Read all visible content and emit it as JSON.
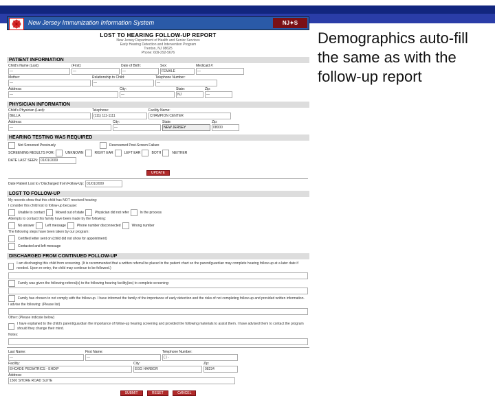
{
  "bars": {
    "system_title": "New Jersey Immunization Information System",
    "badge": "NJ✦S"
  },
  "header": {
    "report_title": "LOST TO HEARING FOLLOW-UP REPORT",
    "line1": "New Jersey Department of Health and Senior Services",
    "line2": "Early Hearing Detection and Intervention Program",
    "line3": "Trenton, NJ 08625",
    "line4": "Phone: 609-292-5676"
  },
  "sections": {
    "patient": "PATIENT INFORMATION",
    "physician": "PHYSICIAN INFORMATION",
    "required": "HEARING TESTING WAS REQUIRED",
    "lost": "LOST TO FOLLOW-UP",
    "discharged": "DISCHARGED FROM CONTINUED FOLLOW-UP"
  },
  "patient": {
    "l_name": "Child's Name (Last):",
    "v_name": "—",
    "l_first": "(First):",
    "v_first": "—",
    "l_dob": "Date of Birth:",
    "v_dob": "—",
    "l_sex": "Sex:",
    "v_sex": "FEMALE",
    "l_med": "Medicaid #:",
    "v_med": "—",
    "l_mother": "Mother:",
    "v_mother": "—",
    "l_rel": "Relationship to Child:",
    "v_rel": "—",
    "l_phone": "Telephone Number:",
    "v_phone": "—",
    "l_addr": "Address:",
    "v_addr": "—",
    "l_city": "City:",
    "v_city": "—",
    "l_state": "State:",
    "v_state": "NJ",
    "l_zip": "Zip:",
    "v_zip": "—"
  },
  "physician": {
    "l_name": "Child's Physician (Last):",
    "v_name": "BELLA",
    "l_phone": "Telephone:",
    "v_phone": "(111) 111-1111",
    "l_fac": "Facility Name:",
    "v_fac": "CHAMPION CENTER",
    "l_addr": "Address:",
    "v_addr": "—",
    "l_city": "City:",
    "v_city": "—",
    "l_state": "State:",
    "v_state": "NEW JERSEY",
    "l_zip": "Zip:",
    "v_zip": "08000"
  },
  "required": {
    "opt1": "Not Screened Previously",
    "opt2": "Rescreened Post-Screen Failure",
    "earline": "SCREENING RESULTS FOR:",
    "u": "UNKNOWN",
    "r": "RIGHT EAR",
    "l": "LEFT EAR",
    "b": "BOTH",
    "n": "NEITHER",
    "date_label": "DATE LAST SEEN:",
    "date_val": "01/01/2009",
    "btn": "UPDATE",
    "dis_label": "Date Patient Lost to / Discharged from Follow-Up:",
    "dis_val": "01/01/2009"
  },
  "lost": {
    "line1": "My records show that this child has NOT received hearing:",
    "line2": "I consider this child lost to follow-up because:",
    "c1": "Unable to contact",
    "c2": "Moved out of state",
    "c3": "Physician did not refer",
    "c4": "In the process",
    "line3": "Attempts to contact this family have been made by the following:",
    "d1": "No answer",
    "d2": "Left message",
    "d3": "Phone number disconnected",
    "d4": "Wrong number",
    "line4": "The following steps have been taken by our program:",
    "c5": "Certified letter sent on (child did not show for appointment)",
    "c6": "Contacted and left message"
  },
  "discharged": {
    "p1": "I am discharging this child from screening. (It is recommended that a written referral be placed in the patient chart so the parent/guardian may complete hearing follow-up at a later date if needed. Upon re-entry, the child may continue to be followed.)",
    "p2": "Family was given the following referral(s) to the following hearing facility(ies) to complete screening:",
    "p3": "Family has chosen to not comply with the follow-up. I have informed the family of the importance of early detection and the risks of not completing follow-up and provided written information.",
    "p4": "I advise the following: (Please list)",
    "p5": "Other: (Please indicate below)",
    "p6": "I have explained to the child's parent/guardian the importance of follow-up hearing screening and provided the following materials to assist them. I have advised them to contact the program should they change their mind.",
    "p7": "Notes:"
  },
  "footer": {
    "l_name": "Last Name:",
    "v_name": "—",
    "l_first": "First Name:",
    "v_first": "—",
    "l_phone": "Telephone Number:",
    "v_phone": "(   )   -",
    "l_fac": "Facility:",
    "v_fac": "EHCADE PEDIATRICS - EHDIP",
    "l_city": "City:",
    "v_city": "EGG HARBOR",
    "l_zip": "Zip:",
    "v_zip": "08234",
    "l_addr": "Address:",
    "v_addr": "1500 SHORE ROAD SUITE",
    "b1": "SUBMIT",
    "b2": "RESET",
    "b3": "CANCEL"
  },
  "annotation": "Demographics auto-fill the same as with the follow-up report"
}
